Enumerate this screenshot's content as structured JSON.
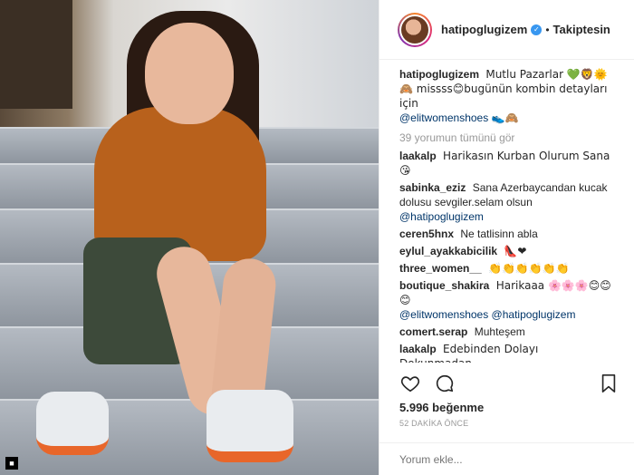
{
  "post": {
    "username": "hatipoglugizem",
    "verified_icon": "verified-badge-icon",
    "follow_status": "Takiptesin",
    "caption": {
      "username": "hatipoglugizem",
      "text_1": "Mutlu Pazarlar 💚🦁🌞",
      "text_2": "🙈 missss😊bugünün kombin detayları için",
      "mention": "@elitwomenshoes",
      "text_3": "👟🙈"
    },
    "view_all": "39 yorumun tümünü gör",
    "likes": "5.996 beğenme",
    "time": "52 DAKİKA ÖNCE",
    "comment_placeholder": "Yorum ekle..."
  },
  "comments": [
    {
      "user": "laakalp",
      "text": "Harikasın Kurban Olurum Sana😘",
      "mention": ""
    },
    {
      "user": "sabinka_eziz",
      "text": "Sana Azerbaycandan kucak dolusu sevgiler.selam olsun",
      "mention": "@hatipoglugizem"
    },
    {
      "user": "ceren5hnx",
      "text": "Ne tatlisinn abla",
      "mention": ""
    },
    {
      "user": "eylul_ayakkabicilik",
      "text": "👠❤",
      "mention": ""
    },
    {
      "user": "three_women__",
      "text": "👏👏👏👏👏👏",
      "mention": ""
    },
    {
      "user": "boutique_shakira",
      "text": "Harikaaa 🌸🌸🌸😊😊😊",
      "mention": "@elitwomenshoes @hatipoglugizem"
    },
    {
      "user": "comert.serap",
      "text": "Muhteşem",
      "mention": ""
    },
    {
      "user": "laakalp",
      "text": "Edebinden Dolayı Dokunmadan.. Görmeden....Göremeden.🌷 Özleyen",
      "mention": ""
    }
  ],
  "icons": {
    "like": "heart-icon",
    "comment": "comment-icon",
    "save": "bookmark-icon"
  }
}
